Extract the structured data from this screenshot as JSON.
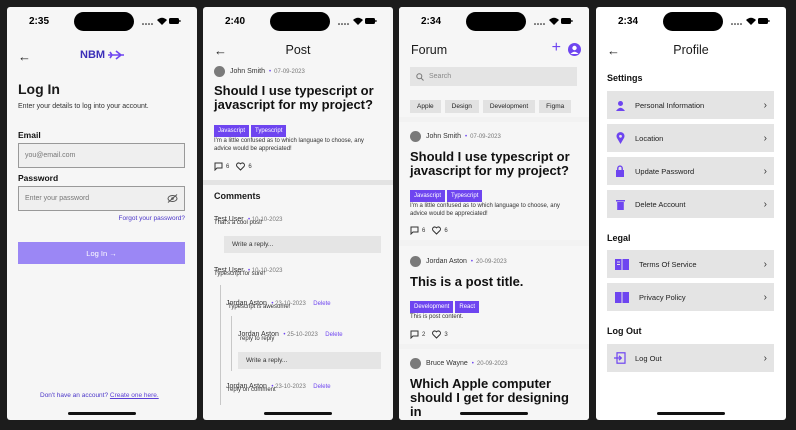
{
  "colors": {
    "accent": "#6e45f0",
    "button": "#9b87f5",
    "navy": "#3b2fb8"
  },
  "login": {
    "time": "2:35",
    "logo": "NBM",
    "title": "Log In",
    "subtitle": "Enter your details to log into your account.",
    "email_label": "Email",
    "email_placeholder": "you@email.com",
    "password_label": "Password",
    "password_placeholder": "Enter your password",
    "forgot": "Forgot your password?",
    "submit": "Log In →",
    "footer_text": "Don't have an account?",
    "footer_link": "Create one here."
  },
  "post": {
    "time": "2:40",
    "header": "Post",
    "author": "John Smith",
    "date": "07-09-2023",
    "title": "Should I use typescript or javascript for my project?",
    "tags": [
      "Javascript",
      "Typescript"
    ],
    "body": "I'm a little confused as to which language to choose, any advice would be appreciated!",
    "comments_count": "6",
    "likes_count": "6",
    "comments_header": "Comments",
    "comments": [
      {
        "author": "Test User",
        "date": "10-10-2023",
        "text": "That's a cool post!",
        "reply_placeholder": "Write a reply..."
      },
      {
        "author": "Test User",
        "date": "10-10-2023",
        "text": "Typescript for sure!"
      },
      {
        "author": "Jordan Aston",
        "date": "23-10-2023",
        "delete": "Delete",
        "text": "Typescript is awesome!"
      },
      {
        "author": "Jordan Aston",
        "date": "25-10-2023",
        "delete": "Delete",
        "text": "reply to reply",
        "reply_placeholder": "Write a reply..."
      },
      {
        "author": "Jordan Aston",
        "date": "23-10-2023",
        "delete": "Delete",
        "text": "reply on comment"
      }
    ]
  },
  "forum": {
    "time": "2:34",
    "header": "Forum",
    "search_placeholder": "Search",
    "chips": [
      "Apple",
      "Design",
      "Development",
      "Figma"
    ],
    "posts": [
      {
        "author": "John Smith",
        "date": "07-09-2023",
        "title": "Should I use typescript or javascript for my project?",
        "tags": [
          "Javascript",
          "Typescript"
        ],
        "body": "I'm a little confused as to which language to choose, any advice would be appreciated!",
        "comments": "6",
        "likes": "6"
      },
      {
        "author": "Jordan Aston",
        "date": "20-09-2023",
        "title": "This is a post title.",
        "tags": [
          "Development",
          "React"
        ],
        "body": "This is post content.",
        "comments": "2",
        "likes": "3"
      },
      {
        "author": "Bruce Wayne",
        "date": "20-09-2023",
        "title": "Which Apple computer should I get for designing in"
      }
    ]
  },
  "profile": {
    "time": "2:34",
    "header": "Profile",
    "settings_label": "Settings",
    "settings": [
      "Personal Information",
      "Location",
      "Update Password",
      "Delete Account"
    ],
    "legal_label": "Legal",
    "legal": [
      "Terms Of Service",
      "Privacy Policy"
    ],
    "logout_label": "Log Out",
    "logout": "Log Out"
  }
}
